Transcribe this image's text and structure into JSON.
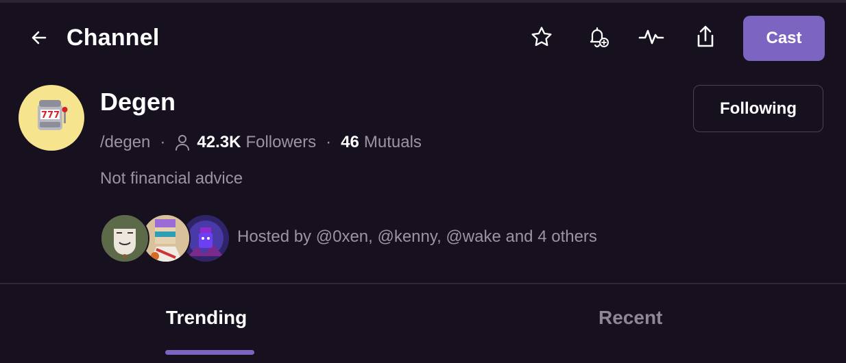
{
  "header": {
    "title": "Channel",
    "back_icon": "arrow-left-icon",
    "actions": [
      {
        "name": "favorite",
        "icon": "star-icon"
      },
      {
        "name": "notifications",
        "icon": "bell-plus-icon"
      },
      {
        "name": "activity",
        "icon": "activity-icon"
      },
      {
        "name": "share",
        "icon": "share-icon"
      }
    ],
    "cast_label": "Cast"
  },
  "channel": {
    "name": "Degen",
    "handle": "/degen",
    "followers_count": "42.3K",
    "followers_label": "Followers",
    "mutuals_count": "46",
    "mutuals_label": "Mutuals",
    "description": "Not financial advice",
    "following_label": "Following",
    "avatar_icon": "slot-machine-icon",
    "hosted_by": "Hosted by @0xen, @kenny, @wake and 4 others"
  },
  "tabs": [
    {
      "label": "Trending",
      "active": true
    },
    {
      "label": "Recent",
      "active": false
    }
  ],
  "colors": {
    "background": "#17101f",
    "accent": "#7c65c1",
    "muted_text": "#9a94a6",
    "avatar_bg": "#f7e48e"
  }
}
